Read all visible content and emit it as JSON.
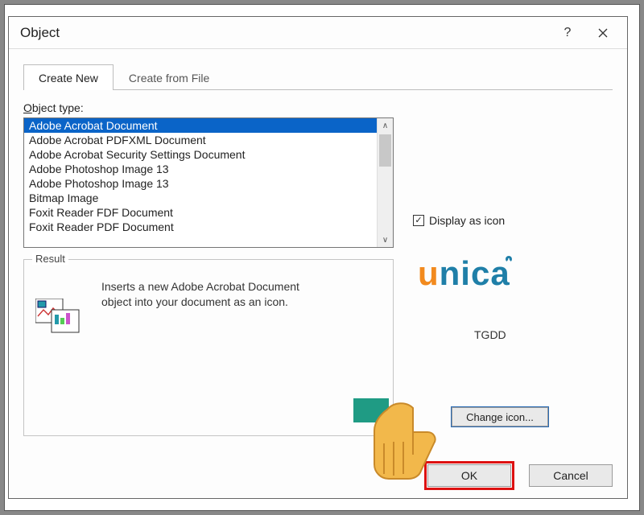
{
  "title": "Object",
  "help_symbol": "?",
  "tabs": {
    "create_new": "Create New",
    "create_from_file": "Create from File"
  },
  "object_type_label_pre": "O",
  "object_type_label_rest": "bject type:",
  "object_types": [
    "Adobe Acrobat Document",
    "Adobe Acrobat PDFXML Document",
    "Adobe Acrobat Security Settings Document",
    "Adobe Photoshop Image 13",
    "Adobe Photoshop Image 13",
    "Bitmap Image",
    "Foxit Reader FDF Document",
    "Foxit Reader PDF Document"
  ],
  "result_legend": "Result",
  "result_text": "Inserts a new Adobe Acrobat Document object into your document as an icon.",
  "display_as_icon_label": "Display as icon",
  "display_as_icon_checked": "✓",
  "icon_caption": "TGDD",
  "change_icon_label": "Change icon...",
  "buttons": {
    "ok": "OK",
    "cancel": "Cancel"
  },
  "logo": {
    "u": "u",
    "rest": "nica"
  }
}
